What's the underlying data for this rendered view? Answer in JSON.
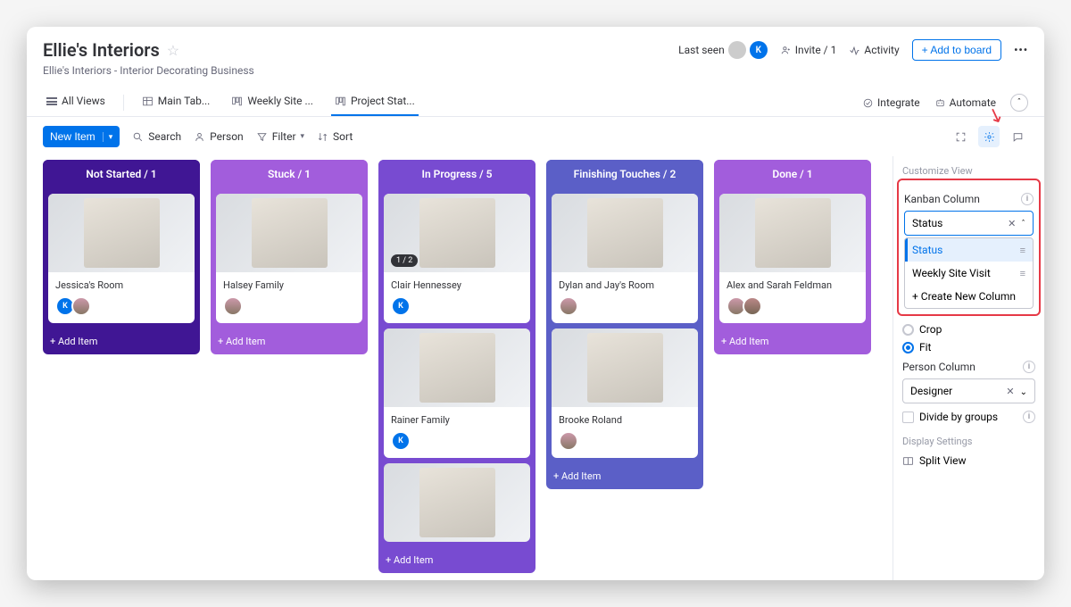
{
  "header": {
    "title": "Ellie's Interiors",
    "subtitle": "Ellie's Interiors - Interior Decorating Business",
    "lastseen_label": "Last seen",
    "invite_label": "Invite / 1",
    "activity_label": "Activity",
    "add_board_label": "+  Add to board"
  },
  "views": {
    "all_views": "All Views",
    "tabs": [
      "Main Tab...",
      "Weekly Site ...",
      "Project Stat..."
    ],
    "active_index": 2,
    "integrate": "Integrate",
    "automate": "Automate"
  },
  "toolbar": {
    "new_item": "New Item",
    "search": "Search",
    "person": "Person",
    "filter": "Filter",
    "sort": "Sort"
  },
  "columns": [
    {
      "title": "Not Started / 1",
      "color": "c0",
      "cards": [
        {
          "title": "Jessica's Room",
          "avatars": [
            "k",
            "p1"
          ]
        }
      ]
    },
    {
      "title": "Stuck / 1",
      "color": "c1",
      "cards": [
        {
          "title": "Halsey Family",
          "avatars": [
            "p1"
          ]
        }
      ]
    },
    {
      "title": "In Progress / 5",
      "color": "c2",
      "cards": [
        {
          "title": "Clair Hennessey",
          "badge": "1 / 2",
          "avatars": [
            "k"
          ]
        },
        {
          "title": "Rainer Family",
          "avatars": [
            "k"
          ]
        },
        {
          "title": "",
          "avatars": []
        }
      ]
    },
    {
      "title": "Finishing Touches / 2",
      "color": "c3",
      "cards": [
        {
          "title": "Dylan and Jay's Room",
          "avatars": [
            "p1"
          ]
        },
        {
          "title": "Brooke Roland",
          "avatars": [
            "p1"
          ]
        }
      ]
    },
    {
      "title": "Done / 1",
      "color": "c4",
      "cards": [
        {
          "title": "Alex and Sarah Feldman",
          "avatars": [
            "p1",
            "p2"
          ]
        }
      ]
    }
  ],
  "add_item_label": "+ Add Item",
  "sidebar": {
    "customize_label": "Customize View",
    "kanban_label": "Kanban Column",
    "kanban_value": "Status",
    "dropdown": {
      "status": "Status",
      "weekly": "Weekly Site Visit",
      "create": "+ Create New Column"
    },
    "crop_label": "Crop",
    "fit_label": "Fit",
    "person_label": "Person Column",
    "person_value": "Designer",
    "divide_label": "Divide by groups",
    "display_label": "Display Settings",
    "split_label": "Split View"
  }
}
